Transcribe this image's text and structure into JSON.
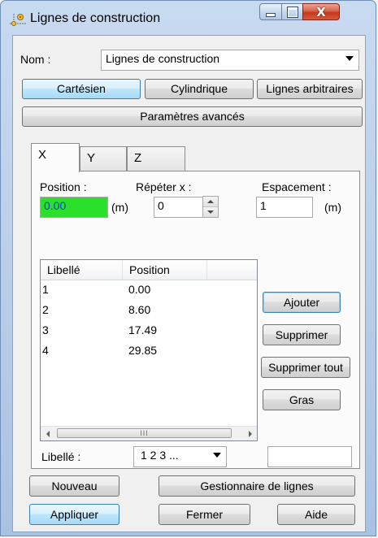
{
  "window": {
    "title": "Lignes de construction",
    "icon": "construction-lines-icon",
    "close_glyph": "X"
  },
  "nom": {
    "label": "Nom :",
    "value": "Lignes de construction"
  },
  "mode_buttons": {
    "cartesien": "Cartésien",
    "cylindrique": "Cylindrique",
    "arbitraires": "Lignes arbitraires",
    "selected": "Cartésien"
  },
  "advanced_label": "Paramètres avancés",
  "tabs": {
    "x": "X",
    "y": "Y",
    "z": "Z",
    "selected": "X"
  },
  "position": {
    "label": "Position :",
    "value": "0.00",
    "unit": "(m)"
  },
  "repeter": {
    "label": "Répéter x :",
    "value": "0"
  },
  "espacement": {
    "label": "Espacement :",
    "value": "1",
    "unit": "(m)"
  },
  "list": {
    "columns": [
      "Libellé",
      "Position"
    ],
    "rows": [
      {
        "label": "1",
        "position": "0.00"
      },
      {
        "label": "2",
        "position": "8.60"
      },
      {
        "label": "3",
        "position": "17.49"
      },
      {
        "label": "4",
        "position": "29.85"
      }
    ],
    "scroll_thumb": "III"
  },
  "side_buttons": {
    "ajouter": "Ajouter",
    "supprimer": "Supprimer",
    "supprimer_tout": "Supprimer tout",
    "gras": "Gras"
  },
  "libelle": {
    "label": "Libellé :",
    "value": "1 2 3 ...",
    "extra_value": ""
  },
  "footer": {
    "nouveau": "Nouveau",
    "gestionnaire": "Gestionnaire de lignes",
    "appliquer": "Appliquer",
    "fermer": "Fermer",
    "aide": "Aide"
  },
  "colors": {
    "highlight": "#2be02b",
    "active_button": "#bee6fd",
    "close_button": "#c23a1f"
  }
}
